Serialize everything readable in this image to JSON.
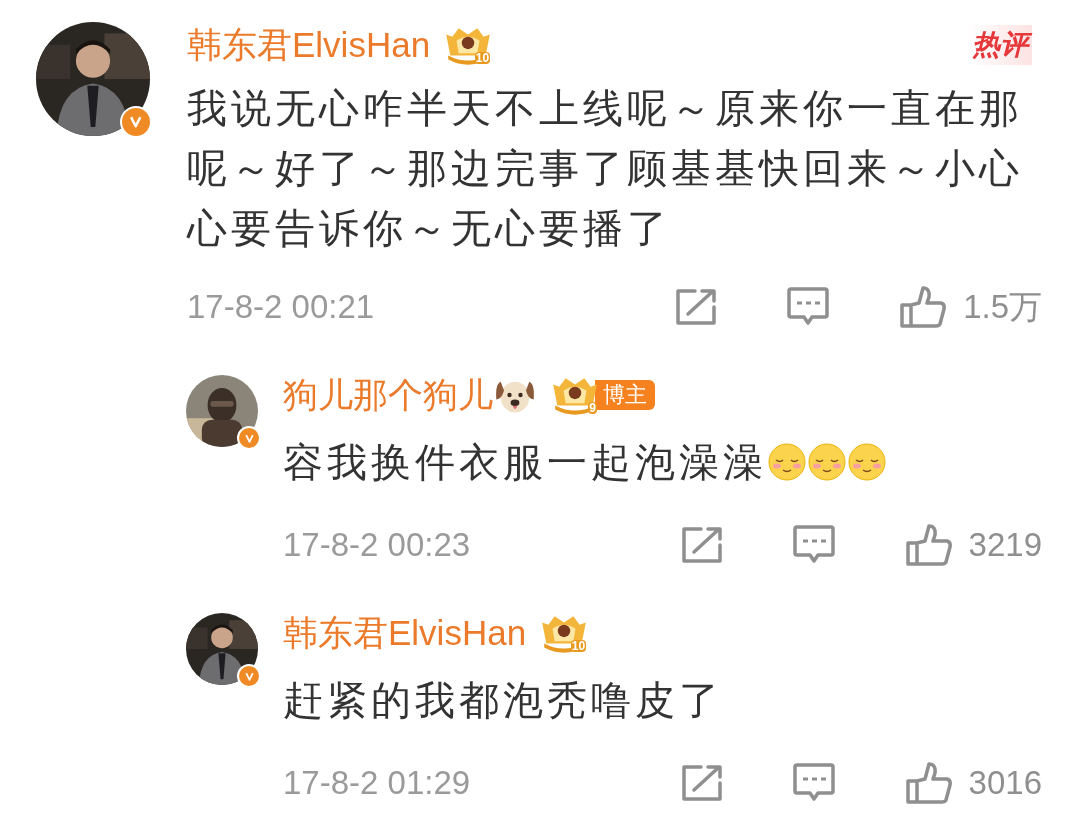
{
  "comments": [
    {
      "kind": "comment",
      "author": "韩东君ElvisHan",
      "verified": true,
      "level_badge": "10",
      "hot_label": "热评",
      "text": "我说无心咋半天不上线呢～原来你一直在那呢～好了～那边完事了顾基基快回来～小心心要告诉你～无心要播了",
      "time": "17-8-2 00:21",
      "likes": "1.5万"
    },
    {
      "kind": "reply",
      "author": "狗儿那个狗儿",
      "verified": true,
      "name_emoji": {
        "kind": "dog"
      },
      "level_badge": "9",
      "tag": "博主",
      "text": "容我换件衣服一起泡澡澡",
      "emojis": [
        {
          "kind": "blush"
        },
        {
          "kind": "blush"
        },
        {
          "kind": "blush"
        }
      ],
      "time": "17-8-2 00:23",
      "likes": "3219"
    },
    {
      "kind": "reply",
      "author": "韩东君ElvisHan",
      "verified": true,
      "level_badge": "10",
      "text": "赶紧的我都泡秃噜皮了",
      "time": "17-8-2 01:29",
      "likes": "3016"
    }
  ]
}
